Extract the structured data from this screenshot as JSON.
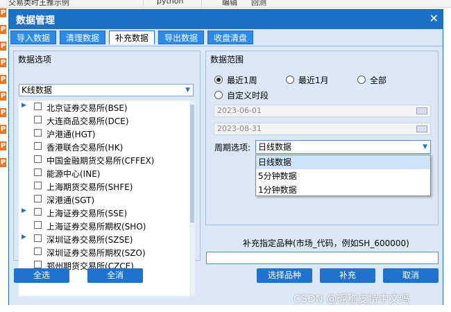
{
  "background": {
    "header_cells": [
      "交易类时王推示例",
      "python",
      "编辑",
      "回测"
    ],
    "row_icon_letter": "P"
  },
  "dialog": {
    "title": "数据管理",
    "close_glyph": "✕"
  },
  "tabs": [
    {
      "label": "导入数据",
      "active": false
    },
    {
      "label": "清理数据",
      "active": false
    },
    {
      "label": "补充数据",
      "active": true
    },
    {
      "label": "导出数据",
      "active": false
    },
    {
      "label": "收盘清盘",
      "active": false
    }
  ],
  "left_panel": {
    "title": "数据选项",
    "kind_value": "K线数据",
    "markets": [
      {
        "label": "北京证券交易所(BSE)",
        "expandable": true
      },
      {
        "label": "大连商品交易所(DCE)",
        "expandable": false
      },
      {
        "label": "沪港通(HGT)",
        "expandable": false
      },
      {
        "label": "香港联合交易所(HK)",
        "expandable": false
      },
      {
        "label": "中国金融期货交易所(CFFEX)",
        "expandable": false
      },
      {
        "label": "能源中心(INE)",
        "expandable": false
      },
      {
        "label": "上海期货交易所(SHFE)",
        "expandable": false
      },
      {
        "label": "深港通(SGT)",
        "expandable": false
      },
      {
        "label": "上海证券交易所(SSE)",
        "expandable": true
      },
      {
        "label": "上海证券交易所期权(SHO)",
        "expandable": false
      },
      {
        "label": "深圳证券交易所(SZSE)",
        "expandable": true
      },
      {
        "label": "深圳证券交易所期权(SZO)",
        "expandable": false
      },
      {
        "label": "郑州期货交易所(CZCE)",
        "expandable": false
      }
    ]
  },
  "right_panel": {
    "title": "数据范围",
    "radios": [
      {
        "label": "最近1周",
        "checked": true
      },
      {
        "label": "最近1月",
        "checked": false
      },
      {
        "label": "全部",
        "checked": false
      },
      {
        "label": "自定义时段",
        "checked": false
      }
    ],
    "start_date": "2023-06-01",
    "end_date": "2023-08-31",
    "period_label": "周期选项:",
    "period_value": "日线数据",
    "period_options": [
      {
        "label": "日线数据",
        "selected": true
      },
      {
        "label": "5分钟数据",
        "selected": false
      },
      {
        "label": "1分钟数据",
        "selected": false
      }
    ],
    "symbol_label": "补充指定品种(市场_代码，例如SH_600000)",
    "symbol_value": ""
  },
  "buttons": {
    "select_all": "全选",
    "deselect_all": "全消",
    "choose_symbol": "选择品种",
    "supplement": "补充",
    "cancel": "取消"
  },
  "watermark": "CSDN @昵称支持中文吗"
}
